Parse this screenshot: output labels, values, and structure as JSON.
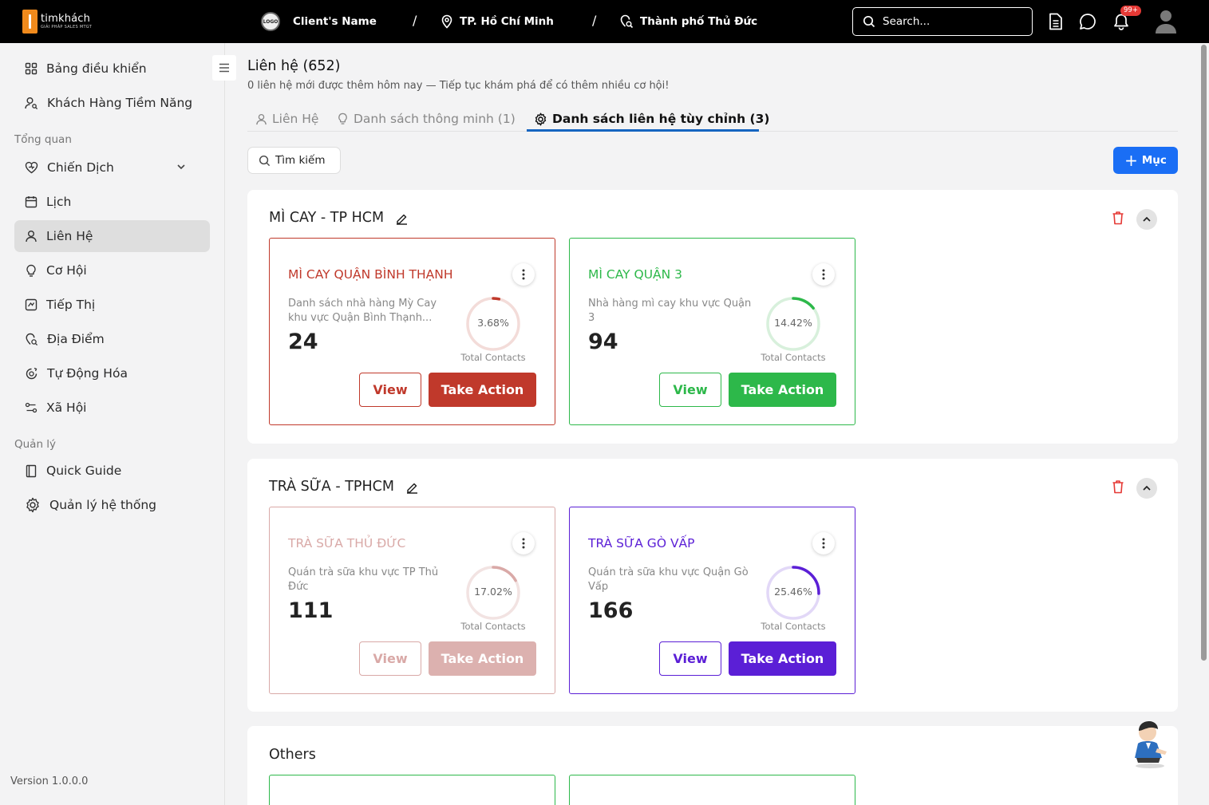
{
  "topbar": {
    "brand_name": "timkhách",
    "brand_tagline": "GIẢI PHÁP SALES MTGT",
    "logo_text": "LOGO",
    "client_name": "Client's Name",
    "separator": "/",
    "city": "TP. Hồ Chí Minh",
    "district": "Thành phố Thủ Đức",
    "search_placeholder": "Search...",
    "notification_badge": "99+"
  },
  "sidebar": {
    "items_top": [
      {
        "label": "Bảng điều khiển",
        "icon": "dashboard-icon"
      },
      {
        "label": "Khách Hàng Tiềm Năng",
        "icon": "user-icon"
      }
    ],
    "section_overview": "Tổng quan",
    "items_overview": [
      {
        "label": "Chiến Dịch",
        "icon": "heart-icon"
      },
      {
        "label": "Lịch",
        "icon": "calendar-icon"
      },
      {
        "label": "Liên Hệ",
        "icon": "user-icon",
        "active": true
      },
      {
        "label": "Cơ Hội",
        "icon": "lightbulb-icon"
      },
      {
        "label": "Tiếp Thị",
        "icon": "chart-icon"
      },
      {
        "label": "Địa Điểm",
        "icon": "location-icon"
      },
      {
        "label": "Tự Động Hóa",
        "icon": "automation-icon"
      },
      {
        "label": "Xã Hội",
        "icon": "social-icon"
      }
    ],
    "section_manage": "Quản lý",
    "items_manage": [
      {
        "label": "Quick Guide",
        "icon": "book-icon"
      },
      {
        "label": "Quản lý hệ thống",
        "icon": "gear-icon"
      }
    ],
    "version": "Version 1.0.0.0"
  },
  "main": {
    "title": "Liên hệ (652)",
    "subtitle": "0 liên hệ mới được thêm hôm nay — Tiếp tục khám phá để có thêm nhiều cơ hội!",
    "tabs": [
      {
        "label": "Liên Hệ"
      },
      {
        "label": "Danh sách thông minh (1)"
      },
      {
        "label": "Danh sách liên hệ tùy chỉnh (3)",
        "active": true
      }
    ],
    "search_chip": "Tìm kiếm",
    "add_button": "Mục",
    "view_label": "View",
    "action_label": "Take Action",
    "ring_caption": "Total Contacts",
    "groups": [
      {
        "title": "MÌ CAY - TP HCM",
        "cards": [
          {
            "name": "MÌ CAY QUẬN BÌNH THẠNH",
            "description": "Danh sách nhà hàng Mỳ Cay khu vực Quận Bình Thạnh...",
            "count": "24",
            "percent": 3.68,
            "percent_label": "3.68%",
            "color": "#c0392b",
            "track": "#f3dcd9",
            "button_bg": "#c0392b",
            "name_color": "#c0392b",
            "faded": false
          },
          {
            "name": "MÌ CAY QUẬN 3",
            "description": "Nhà hàng mì cay khu vực Quận 3",
            "count": "94",
            "percent": 14.42,
            "percent_label": "14.42%",
            "color": "#2db84a",
            "track": "#d8f0dc",
            "button_bg": "#2db84a",
            "name_color": "#2db84a",
            "faded": false
          }
        ]
      },
      {
        "title": "TRÀ SỮA - TPHCM",
        "cards": [
          {
            "name": "TRÀ SỮA THỦ ĐỨC",
            "description": "Quán trà sữa khu vực TP Thủ Đức",
            "count": "111",
            "percent": 17.02,
            "percent_label": "17.02%",
            "color": "#d9a9a7",
            "track": "#f2e3e2",
            "button_bg": "#dcb1af",
            "name_color": "#d9a9a7",
            "faded": true
          },
          {
            "name": "TRÀ SỮA GÒ VẤP",
            "description": "Quán trà sữa khu vực Quận Gò Vấp",
            "count": "166",
            "percent": 25.46,
            "percent_label": "25.46%",
            "color": "#5b1fd6",
            "track": "#e2d8f7",
            "button_bg": "#5b1fd6",
            "name_color": "#5b1fd6",
            "faded": false
          }
        ]
      },
      {
        "title": "Others",
        "cards": [
          {
            "color": "#2db84a"
          },
          {
            "color": "#2db84a"
          }
        ]
      }
    ]
  }
}
